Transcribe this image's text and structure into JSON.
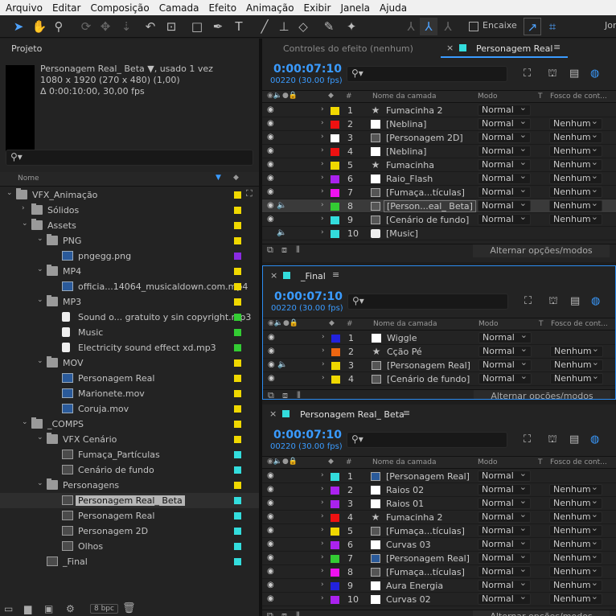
{
  "menu": [
    "Arquivo",
    "Editar",
    "Composição",
    "Camada",
    "Efeito",
    "Animação",
    "Exibir",
    "Janela",
    "Ajuda"
  ],
  "toolbar": {
    "encaixe_label": "Encaixe",
    "workspace": "Jor"
  },
  "project": {
    "panel_title": "Projeto",
    "selected_name": "Personagem Real_ Beta ▼",
    "used": ", usado 1 vez",
    "dims": "1080 x 1920  (270 x 480) (1,00)",
    "duration": "Δ 0:00:10:00, 30,00 fps",
    "col_name": "Nome",
    "bpc": "8 bpc",
    "items": [
      {
        "label": "VFX_Animação",
        "type": "folder",
        "indent": 0,
        "open": true,
        "color": "#f0d800"
      },
      {
        "label": "Sólidos",
        "type": "folder",
        "indent": 1,
        "open": false,
        "color": "#f0d800"
      },
      {
        "label": "Assets",
        "type": "folder",
        "indent": 1,
        "open": true,
        "color": "#f0d800"
      },
      {
        "label": "PNG",
        "type": "folder",
        "indent": 2,
        "open": true,
        "color": "#f0d800"
      },
      {
        "label": "pngegg.png",
        "type": "file",
        "indent": 3,
        "color": "#8a2be2"
      },
      {
        "label": "MP4",
        "type": "folder",
        "indent": 2,
        "open": true,
        "color": "#f0d800"
      },
      {
        "label": "officia...14064_musicaldown.com.mp4",
        "type": "file",
        "indent": 3,
        "color": "#f0d800"
      },
      {
        "label": "MP3",
        "type": "folder",
        "indent": 2,
        "open": true,
        "color": "#f0d800"
      },
      {
        "label": "Sound o... gratuito y sin copyright.mp3",
        "type": "audio",
        "indent": 3,
        "color": "#33cc33"
      },
      {
        "label": "Music",
        "type": "audio",
        "indent": 3,
        "color": "#33cc33"
      },
      {
        "label": "Electricity sound effect xd.mp3",
        "type": "audio",
        "indent": 3,
        "color": "#33cc33"
      },
      {
        "label": "MOV",
        "type": "folder",
        "indent": 2,
        "open": true,
        "color": "#f0d800"
      },
      {
        "label": "Personagem Real",
        "type": "file",
        "indent": 3,
        "color": "#f0d800"
      },
      {
        "label": "Marionete.mov",
        "type": "file",
        "indent": 3,
        "color": "#f0d800"
      },
      {
        "label": "Coruja.mov",
        "type": "file",
        "indent": 3,
        "color": "#f0d800"
      },
      {
        "label": "_COMPS",
        "type": "folder",
        "indent": 1,
        "open": true,
        "color": "#f0d800"
      },
      {
        "label": "VFX Cenário",
        "type": "folder",
        "indent": 2,
        "open": true,
        "color": "#f0d800"
      },
      {
        "label": "Fumaça_Partículas",
        "type": "comp",
        "indent": 3,
        "color": "#33dddd"
      },
      {
        "label": "Cenário de fundo",
        "type": "comp",
        "indent": 3,
        "color": "#33dddd"
      },
      {
        "label": "Personagens",
        "type": "folder",
        "indent": 2,
        "open": true,
        "color": "#f0d800"
      },
      {
        "label": "Personagem Real_ Beta",
        "type": "comp",
        "indent": 3,
        "color": "#33dddd",
        "selected": true
      },
      {
        "label": "Personagem Real",
        "type": "comp",
        "indent": 3,
        "color": "#33dddd"
      },
      {
        "label": "Personagem 2D",
        "type": "comp",
        "indent": 3,
        "color": "#33dddd"
      },
      {
        "label": "Olhos",
        "type": "comp",
        "indent": 3,
        "color": "#33dddd"
      },
      {
        "label": "_Final",
        "type": "comp",
        "indent": 2,
        "color": "#33dddd"
      }
    ]
  },
  "header_labels": {
    "mode": "Modo",
    "t": "T",
    "track": "Fosco de cont...",
    "name": "Nome da camada",
    "hash": "#"
  },
  "footer_label": "Alternar opções/modos",
  "timeline1": {
    "tab_inactive": "Controles do efeito  (nenhum)",
    "tab_active": "Personagem Real",
    "time": "0:00:07:10",
    "fps": "00220 (30.00 fps)",
    "layers": [
      {
        "num": "1",
        "name": "Fumacinha 2",
        "color": "#f0d800",
        "type": "star",
        "mode": "Normal",
        "track": ""
      },
      {
        "num": "2",
        "name": "[Neblina]",
        "color": "#ee1111",
        "type": "solid",
        "mode": "Normal",
        "track": "Nenhum"
      },
      {
        "num": "3",
        "name": "[Personagem 2D]",
        "color": "#ffffff",
        "type": "comp",
        "mode": "Normal",
        "track": "Nenhum"
      },
      {
        "num": "4",
        "name": "[Neblina]",
        "color": "#ee1111",
        "type": "solid",
        "mode": "Normal",
        "track": "Nenhum"
      },
      {
        "num": "5",
        "name": "Fumacinha",
        "color": "#f0d800",
        "type": "star",
        "mode": "Normal",
        "track": "Nenhum"
      },
      {
        "num": "6",
        "name": "Raio_Flash",
        "color": "#aa22ee",
        "type": "solid",
        "mode": "Normal",
        "track": "Nenhum"
      },
      {
        "num": "7",
        "name": "[Fumaça...tículas]",
        "color": "#ee11ee",
        "type": "comp",
        "mode": "Normal",
        "track": "Nenhum"
      },
      {
        "num": "8",
        "name": "[Person...eal_ Beta]",
        "color": "#33cc33",
        "type": "comp",
        "mode": "Normal",
        "track": "Nenhum",
        "selected": true,
        "audio": true
      },
      {
        "num": "9",
        "name": "[Cenário de fundo]",
        "color": "#33dddd",
        "type": "comp",
        "mode": "Normal",
        "track": "Nenhum"
      },
      {
        "num": "10",
        "name": "[Music]",
        "color": "#33dddd",
        "type": "audio",
        "mode": "",
        "track": "",
        "audio": true,
        "noeye": true
      }
    ]
  },
  "timeline2": {
    "tab": "_Final",
    "time": "0:00:07:10",
    "fps": "00220 (30.00 fps)",
    "layers": [
      {
        "num": "1",
        "name": "Wiggle",
        "color": "#2222dd",
        "type": "solid",
        "mode": "Normal",
        "track": ""
      },
      {
        "num": "2",
        "name": "Cção Pé",
        "color": "#ee6611",
        "type": "star",
        "mode": "Normal",
        "track": "Nenhum"
      },
      {
        "num": "3",
        "name": "[Personagem Real]",
        "color": "#f0d800",
        "type": "comp",
        "mode": "Normal",
        "track": "Nenhum",
        "audio": true
      },
      {
        "num": "4",
        "name": "[Cenário de fundo]",
        "color": "#f0d800",
        "type": "comp",
        "mode": "Normal",
        "track": "Nenhum"
      }
    ]
  },
  "timeline3": {
    "tab": "Personagem Real_ Beta",
    "time": "0:00:07:10",
    "fps": "00220 (30.00 fps)",
    "layers": [
      {
        "num": "1",
        "name": "[Personagem Real]",
        "color": "#33dddd",
        "type": "footage",
        "mode": "Normal",
        "track": ""
      },
      {
        "num": "2",
        "name": "Raios 02",
        "color": "#aa22ee",
        "type": "solid",
        "mode": "Normal",
        "track": "Nenhum"
      },
      {
        "num": "3",
        "name": "Raios 01",
        "color": "#aa22ee",
        "type": "solid",
        "mode": "Normal",
        "track": "Nenhum"
      },
      {
        "num": "4",
        "name": "Fumacinha 2",
        "color": "#ee1111",
        "type": "star",
        "mode": "Normal",
        "track": "Nenhum"
      },
      {
        "num": "5",
        "name": "[Fumaça...tículas]",
        "color": "#f0d800",
        "type": "comp",
        "mode": "Normal",
        "track": "Nenhum"
      },
      {
        "num": "6",
        "name": "Curvas 03",
        "color": "#aa22ee",
        "type": "solid",
        "mode": "Normal",
        "track": "Nenhum"
      },
      {
        "num": "7",
        "name": "[Personagem Real]",
        "color": "#33cc33",
        "type": "footage",
        "mode": "Normal",
        "track": "Nenhum"
      },
      {
        "num": "8",
        "name": "[Fumaça...tículas]",
        "color": "#ee11ee",
        "type": "comp",
        "mode": "Normal",
        "track": "Nenhum"
      },
      {
        "num": "9",
        "name": "Aura Energia",
        "color": "#2222dd",
        "type": "solid",
        "mode": "Normal",
        "track": "Nenhum"
      },
      {
        "num": "10",
        "name": "Curvas 02",
        "color": "#aa22ee",
        "type": "solid",
        "mode": "Normal",
        "track": "Nenhum"
      }
    ]
  }
}
